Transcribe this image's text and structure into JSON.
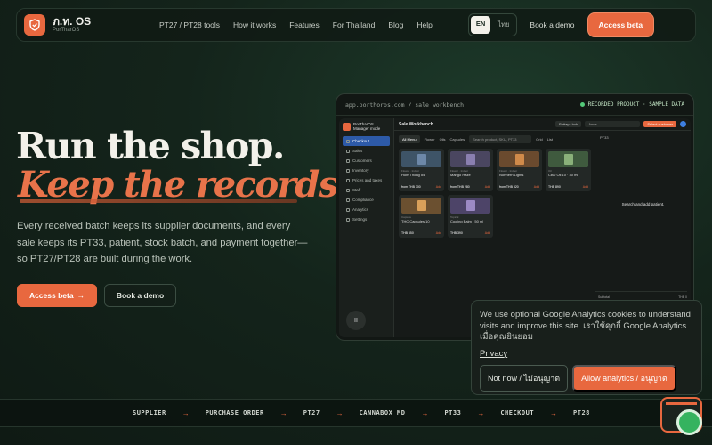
{
  "nav": {
    "brand_name": "ภ.ท. OS",
    "brand_sub": "PorTharOS",
    "links": [
      "PT27 / PT28 tools",
      "How it works",
      "Features",
      "For Thailand",
      "Blog",
      "Help"
    ],
    "lang_en": "EN",
    "lang_th": "ไทย",
    "book_demo": "Book a demo",
    "cta": "Access beta"
  },
  "hero": {
    "title_line1": "Run the shop.",
    "title_line2": "Keep the records.",
    "description": "Every received batch keeps its supplier documents, and every sale keeps its PT33, patient, stock batch, and payment together—so PT27/PT28 are built during the work.",
    "primary_button": "Access beta",
    "primary_arrow": "→",
    "secondary_button": "Book a demo"
  },
  "preview": {
    "url": "app.porthoros.com / sale workbench",
    "badge": "RECORDED PRODUCT · SAMPLE DATA",
    "app": {
      "brand": "PorTharOS",
      "brand_sub": "Manager mode",
      "sidebar": [
        "Checkout",
        "Sales",
        "Customers",
        "Inventory",
        "Prices and taxes",
        "Staff",
        "Compliance",
        "Analytics",
        "Settings"
      ],
      "title": "Sale Workbench",
      "top_pill": "Pattaya hub",
      "top_search": "Anna",
      "top_submit": "Select customer",
      "filters": {
        "all": "All Menu",
        "flower": "Flower",
        "oils": "Oils",
        "capsules": "Capsules",
        "search_placeholder": "Search product, SKU, PT33",
        "grid": "Grid",
        "list": "List"
      },
      "products": [
        {
          "cat": "Flower · Indoor",
          "name": "Hom Thong #4",
          "price": "from THB 300",
          "add": "Add"
        },
        {
          "cat": "Flower · Indoor",
          "name": "Mango Haze",
          "price": "from THB 280",
          "add": "Add"
        },
        {
          "cat": "Flower · Indoor",
          "name": "Northern Lights",
          "price": "from THB 320",
          "add": "Add"
        },
        {
          "cat": "Oil",
          "name": "CBD Oil 10 · 30 ml",
          "price": "THB 890",
          "add": "Add"
        },
        {
          "cat": "Capsule",
          "name": "THC Capsules 10",
          "price": "THB 650",
          "add": "Add"
        },
        {
          "cat": "Topical",
          "name": "Cooling Balm · 50 ml",
          "price": "THB 390",
          "add": "Add"
        }
      ],
      "patient_label": "PT33",
      "patient_message": "Search and add patient.",
      "totals": [
        {
          "label": "Subtotal",
          "value": "THB 0"
        },
        {
          "label": "Discount",
          "value": "THB 0"
        },
        {
          "label": "Total",
          "value": "THB 0"
        }
      ],
      "pause": "II"
    }
  },
  "cookie": {
    "text": "We use optional Google Analytics cookies to understand visits and improve this site. เราใช้คุกกี้ Google Analytics เมื่อคุณยินยอม",
    "privacy": "Privacy",
    "reject": "Not now / ไม่อนุญาต",
    "accept": "Allow analytics / อนุญาต"
  },
  "flow": [
    "SUPPLIER",
    "PURCHASE ORDER",
    "PT27",
    "CANNABOX MD",
    "PT33",
    "CHECKOUT",
    "PT28"
  ],
  "flow_arrow": "→",
  "colors": {
    "accent": "#e8683f",
    "bg": "#14241b",
    "success": "#53c979"
  }
}
